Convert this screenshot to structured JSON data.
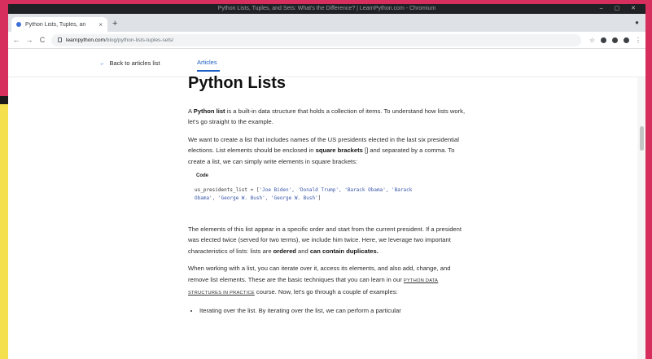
{
  "window": {
    "title": "Python Lists, Tuples, and Sets: What's the Difference? | LearnPython.com - Chromium",
    "controls": "– ▢ ✕"
  },
  "tab": {
    "title": "Python Lists, Tuples, an",
    "close": "×"
  },
  "toolbar": {
    "back": "←",
    "forward": "→",
    "reload": "C",
    "url_host": "learnpython.com",
    "url_path": "/blog/python-lists-tuples-sets/",
    "new_tab": "+",
    "menu": "⋮",
    "tab_menu": "●",
    "star": "☆"
  },
  "site": {
    "back_arrow": "←",
    "back_label": "Back to articles list",
    "articles_tab": "Articles"
  },
  "article": {
    "heading": "Python Lists",
    "p1_a": "A ",
    "p1_b": "Python list",
    "p1_c": " is a built-in data structure that holds a collection of items. To understand how lists work, let's go straight to the example.",
    "p2_a": "We want to create a list that includes names of the US presidents elected in the last six presidential elections. List elements should be enclosed in ",
    "p2_b": "square brackets",
    "p2_c": " [] and separated by a comma. To create a list, we can simply write elements in square brackets:",
    "code_label": "Code",
    "code_line1_a": "us_presidents_list = [",
    "code_line1_b": "'Joe Biden', 'Donald Trump', 'Barack Obama', 'Barack",
    "code_line2": "Obama', 'George W. Bush', 'George W. Bush'",
    "code_line2_end": "]",
    "p3_a": "The elements of this list appear in a specific order and start from the current president. If a president was elected twice (served for two terms), we include him twice. Here, we leverage two important characteristics of lists: lists are ",
    "p3_b": "ordered",
    "p3_c": " and ",
    "p3_d": "can contain duplicates.",
    "p4_a": "When working with a list, you can iterate over it, access its elements, and also add, change, and remove list elements. These are the basic techniques that you can learn in our ",
    "p4_b": "PYTHON DATA STRUCTURES IN PRACTICE",
    "p4_c": " course. Now, let's go through a couple of examples:",
    "bullet1": "Iterating over the list. By iterating over the list, we can perform a particular"
  },
  "colors": {
    "accent": "#1c5fc4",
    "frame": "#d62f5e",
    "desk": "#f4e04d"
  }
}
